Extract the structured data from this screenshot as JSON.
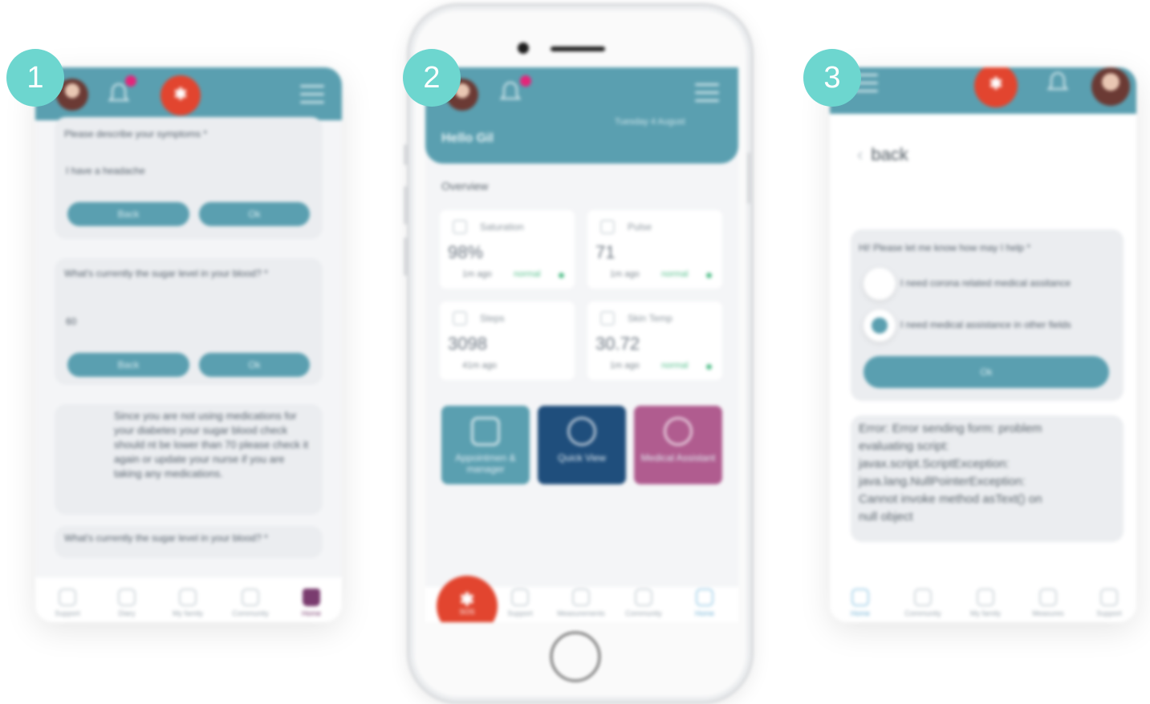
{
  "badges": [
    "1",
    "2",
    "3"
  ],
  "colors": {
    "teal": "#5a9fb0",
    "badge": "#6dd6cf",
    "sos": "#e2452f",
    "darkblue": "#1f4e7c",
    "magenta": "#b05c8f"
  },
  "panel1": {
    "q1": "Please describe your symptoms *",
    "a1": "I have a headache",
    "q2": "What's currently the sugar level in your blood? *",
    "a2": "60",
    "back_label": "Back",
    "ok_label": "Ok",
    "message": "Since you are not using medications for your diabetes your sugar blood check should nt be lower than 70 please check it again or update your nurse if you are taking any medications.",
    "q3": "What's currently the sugar level in your blood? *",
    "nav": [
      "Support",
      "Diary",
      "My family",
      "Community",
      "Home"
    ]
  },
  "phone": {
    "greeting": "Hello Gil",
    "date": "Tuesday 4 August",
    "overview_label": "Overview",
    "metrics": [
      {
        "label": "Saturation",
        "value": "98%",
        "ago": "1m ago",
        "status": "normal"
      },
      {
        "label": "Pulse",
        "value": "71",
        "ago": "1m ago",
        "status": "normal"
      },
      {
        "label": "Steps",
        "value": "3098",
        "ago": "41m ago",
        "status": ""
      },
      {
        "label": "Skin Temp",
        "value": "30.72",
        "ago": "1m ago",
        "status": "normal"
      }
    ],
    "tiles": [
      "Appointmen & manager",
      "Quick View",
      "Medical Assistant"
    ],
    "sos_label": "SOS",
    "nav": [
      "Support",
      "Measurements",
      "Community",
      "Home"
    ]
  },
  "panel3": {
    "back_label": "back",
    "question": "Hi! Please let me know how may I help *",
    "options": [
      "I need corona related medical assitance",
      "I need medical assistance in other fields"
    ],
    "ok_label": "Ok",
    "error": "Error: Error sending form: problem evaluating script: javax.script.ScriptException: java.lang.NullPointerException: Cannot invoke method asText() on null object",
    "nav": [
      "Home",
      "Community",
      "My family",
      "Measures",
      "Support"
    ]
  }
}
